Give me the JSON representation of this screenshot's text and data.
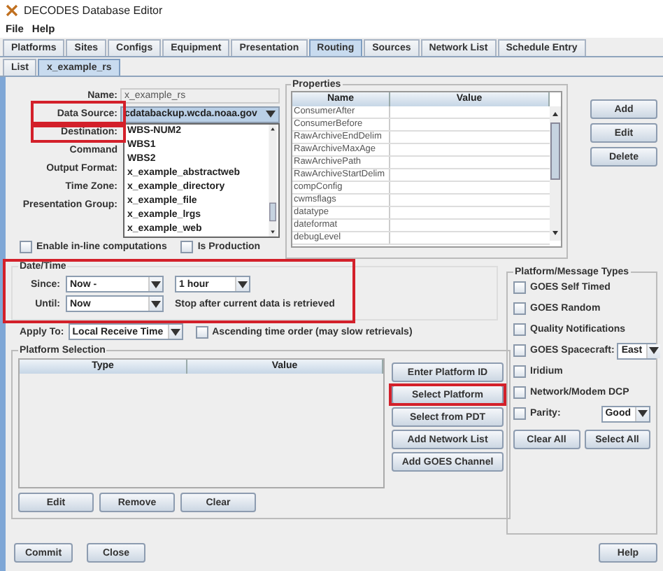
{
  "window": {
    "title": "DECODES Database Editor"
  },
  "menu": [
    "File",
    "Help"
  ],
  "tabs": [
    {
      "label": "Platforms",
      "selected": false
    },
    {
      "label": "Sites",
      "selected": false
    },
    {
      "label": "Configs",
      "selected": false
    },
    {
      "label": "Equipment",
      "selected": false
    },
    {
      "label": "Presentation",
      "selected": false
    },
    {
      "label": "Routing",
      "selected": true
    },
    {
      "label": "Sources",
      "selected": false
    },
    {
      "label": "Network List",
      "selected": false
    },
    {
      "label": "Schedule Entry",
      "selected": false
    }
  ],
  "subtabs": [
    {
      "label": "List",
      "selected": false
    },
    {
      "label": "x_example_rs",
      "selected": true
    }
  ],
  "form": {
    "fields": [
      {
        "label": "Name:",
        "kind": "text",
        "value": "x_example_rs"
      },
      {
        "label": "Data Source:",
        "kind": "combo",
        "value": "cdatabackup.wcda.noaa.gov"
      },
      {
        "label": "Destination:",
        "kind": "hidden"
      },
      {
        "label": "Command",
        "kind": "hidden"
      },
      {
        "label": "Output Format:",
        "kind": "hidden"
      },
      {
        "label": "Time Zone:",
        "kind": "hidden"
      },
      {
        "label": "Presentation Group:",
        "kind": "hidden"
      }
    ],
    "checkboxes": [
      {
        "label": "Enable in-line computations",
        "checked": false
      },
      {
        "label": "Is Production",
        "checked": false
      }
    ]
  },
  "dropdown_list": {
    "items": [
      "WBS-NUM2",
      "WBS1",
      "WBS2",
      "x_example_abstractweb",
      "x_example_directory",
      "x_example_file",
      "x_example_lrgs",
      "x_example_web"
    ]
  },
  "properties": {
    "title": "Properties",
    "columns": [
      "Name",
      "Value"
    ],
    "rows": [
      "ConsumerAfter",
      "ConsumerBefore",
      "RawArchiveEndDelim",
      "RawArchiveMaxAge",
      "RawArchivePath",
      "RawArchiveStartDelim",
      "compConfig",
      "cwmsflags",
      "datatype",
      "dateformat",
      "debugLevel"
    ],
    "buttons": [
      "Add",
      "Edit",
      "Delete"
    ]
  },
  "date_time": {
    "title": "Date/Time",
    "since_label": "Since:",
    "since": "Now -",
    "since_amount": "1 hour",
    "until_label": "Until:",
    "until": "Now",
    "note": "Stop after current data is retrieved"
  },
  "apply_to": {
    "label": "Apply To:",
    "value": "Local Receive Time",
    "ascending_label": "Ascending time order (may slow retrievals)",
    "ascending_checked": false
  },
  "platform_selection": {
    "title": "Platform Selection",
    "columns": [
      "Type",
      "Value"
    ],
    "buttons": [
      "Enter Platform ID",
      "Select Platform",
      "Select from PDT",
      "Add Network List",
      "Add GOES Channel"
    ],
    "bottom_buttons": [
      "Edit",
      "Remove",
      "Clear"
    ]
  },
  "message_types": {
    "title": "Platform/Message Types",
    "items": [
      {
        "kind": "check",
        "label": "GOES Self Timed",
        "checked": false
      },
      {
        "kind": "check",
        "label": "GOES Random",
        "checked": false
      },
      {
        "kind": "check",
        "label": "Quality Notifications",
        "checked": false
      },
      {
        "kind": "combo",
        "label": "GOES Spacecraft:",
        "value": "East",
        "checked": false
      },
      {
        "kind": "check",
        "label": "Iridium",
        "checked": false
      },
      {
        "kind": "check",
        "label": "Network/Modem DCP",
        "checked": false
      },
      {
        "kind": "combo",
        "label": "Parity:",
        "value": "Good",
        "checked": false
      }
    ],
    "buttons": [
      "Clear All",
      "Select All"
    ]
  },
  "footer": {
    "buttons": [
      "Commit",
      "Close"
    ],
    "help": "Help"
  }
}
